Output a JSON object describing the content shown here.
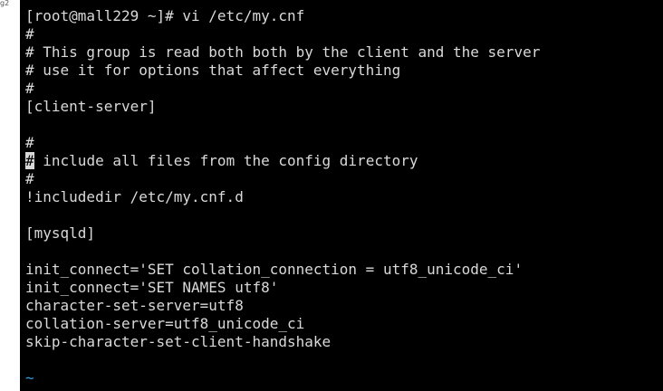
{
  "gutter": {
    "label": "g2"
  },
  "terminal": {
    "prompt_line": "[root@mall229 ~]# vi /etc/my.cnf",
    "lines": [
      "#",
      "# This group is read both both by the client and the server",
      "# use it for options that affect everything",
      "#",
      "[client-server]",
      "",
      "#",
      "",
      "#",
      "!includedir /etc/my.cnf.d",
      "",
      "[mysqld]",
      "",
      "init_connect='SET collation_connection = utf8_unicode_ci'",
      "init_connect='SET NAMES utf8'",
      "character-set-server=utf8",
      "collation-server=utf8_unicode_ci",
      "skip-character-set-client-handshake",
      "",
      "~"
    ],
    "cursor_line": {
      "cursor_char": "#",
      "rest": " include all files from the config directory"
    },
    "colors": {
      "background": "#000000",
      "text": "#d9d9d9",
      "tilde": "#2f9fe0"
    }
  }
}
